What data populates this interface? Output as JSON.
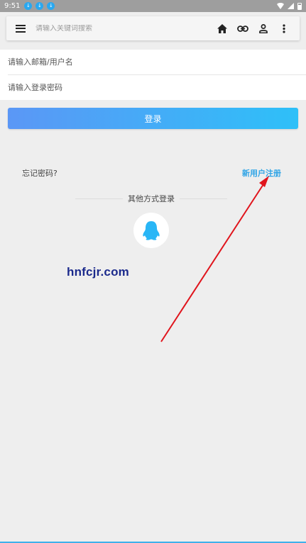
{
  "status_bar": {
    "time": "9:51",
    "notification_icons": [
      "download-icon",
      "download-icon",
      "download-icon"
    ]
  },
  "search": {
    "placeholder": "请输入关键词搜索"
  },
  "header_icons": [
    "home-icon",
    "link-icon",
    "person-icon",
    "more-vert-icon"
  ],
  "form": {
    "email_placeholder": "请输入邮箱/用户名",
    "password_placeholder": "请输入登录密码"
  },
  "login_button_label": "登录",
  "forgot_password": "忘记密码?",
  "register": "新用户注册",
  "other_login_label": "其他方式登录",
  "qq_icon": "qq-penguin-icon",
  "watermark": "hnfcjr.com",
  "colors": {
    "accent_start": "#5b97f6",
    "accent_end": "#2ec0f8",
    "link": "#2fa4e6",
    "arrow": "#e0141c",
    "watermark": "#1b2a8c"
  }
}
